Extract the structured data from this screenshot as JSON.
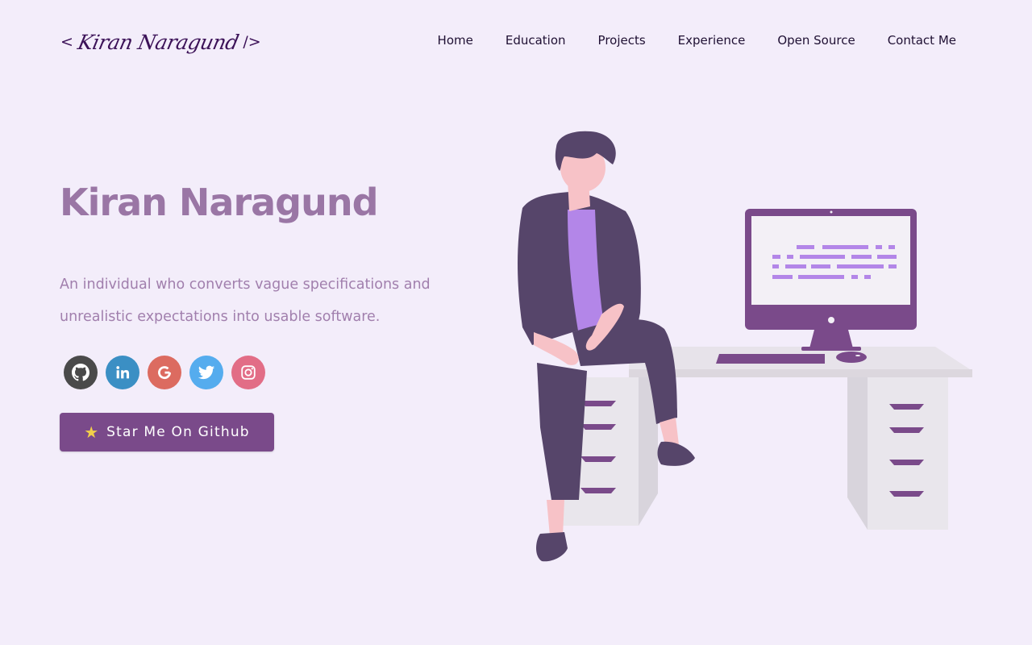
{
  "header": {
    "logo": {
      "open": "<",
      "signature": "Kiran Naragund",
      "close": "/>"
    },
    "nav": [
      "Home",
      "Education",
      "Projects",
      "Experience",
      "Open Source",
      "Contact Me"
    ]
  },
  "hero": {
    "title": "Kiran Naragund",
    "subtitle": "An individual who converts vague specifications and unrealistic expectations into usable software.",
    "socials": [
      {
        "icon": "github-icon",
        "color": "#4a4a4a"
      },
      {
        "icon": "linkedin-icon",
        "color": "#3b8fc4"
      },
      {
        "icon": "google-icon",
        "color": "#dc6b60"
      },
      {
        "icon": "twitter-icon",
        "color": "#55acee"
      },
      {
        "icon": "instagram-icon",
        "color": "#e26d86"
      }
    ],
    "cta": {
      "icon": "★",
      "label": "Star Me On Github"
    }
  },
  "colors": {
    "background": "#f3edfa",
    "accent": "#7a4a8a",
    "title": "#9a76a5",
    "nav_text": "#1f1033"
  }
}
